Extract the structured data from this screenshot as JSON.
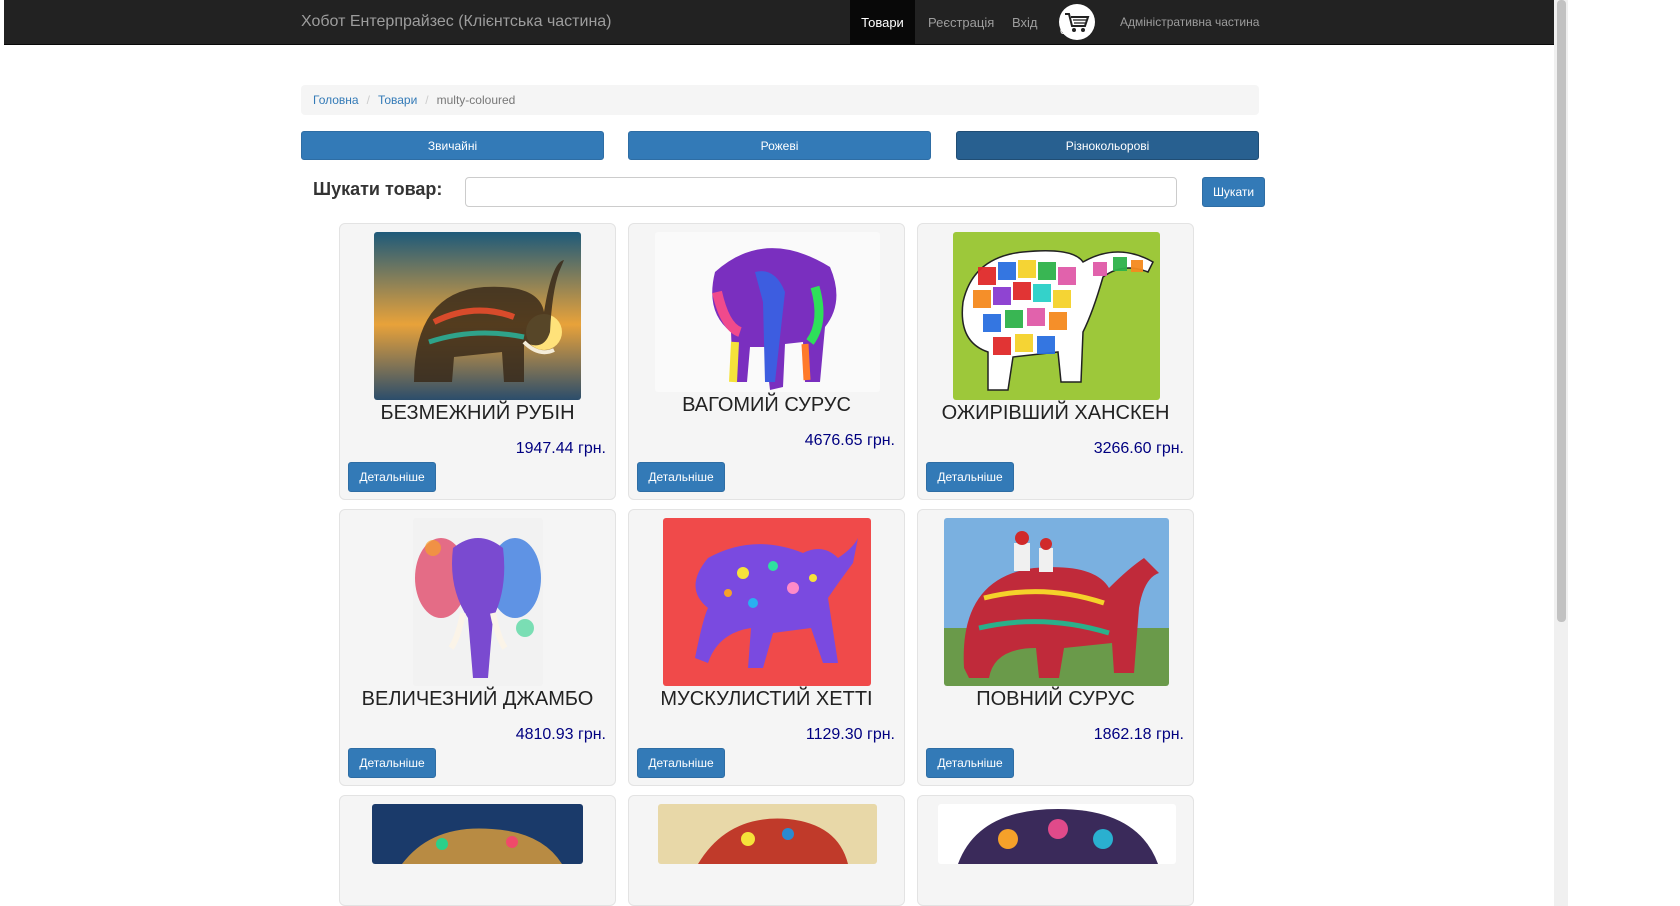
{
  "nav": {
    "brand": "Хобот Ентерпрайзес (Клієнтська частина)",
    "items": [
      "Товари",
      "Реєстрація",
      "Вхід"
    ],
    "active": "Товари",
    "cart_count": "0",
    "admin": "Адміністративна частина"
  },
  "breadcrumb": {
    "home": "Головна",
    "products": "Товари",
    "current": "multy-coloured"
  },
  "categories": [
    "Звичайні",
    "Рожеві",
    "Різнокольорові"
  ],
  "search": {
    "label": "Шукати товар:",
    "value": "",
    "button": "Шукати"
  },
  "products": [
    {
      "name": "БЕЗМЕЖНИЙ РУБІН",
      "price": "1947.44 грн.",
      "details": "Детальніше",
      "image": "elephant-sunset-mandala"
    },
    {
      "name": "ВАГОМИЙ СУРУС",
      "price": "4676.65 грн.",
      "details": "Детальніше",
      "image": "elephant-neon-paint"
    },
    {
      "name": "ОЖИРІВШИЙ ХАНСКЕН",
      "price": "3266.60 грн.",
      "details": "Детальніше",
      "image": "elephant-patchwork"
    },
    {
      "name": "ВЕЛИЧЕЗНИЙ ДЖАМБО",
      "price": "4810.93 грн.",
      "details": "Детальніше",
      "image": "elephant-watercolor"
    },
    {
      "name": "МУСКУЛИСТИЙ ХЕТТІ",
      "price": "1129.30 грн.",
      "details": "Детальніше",
      "image": "elephant-floral-red"
    },
    {
      "name": "ПОВНИЙ СУРУС",
      "price": "1862.18 грн.",
      "details": "Детальніше",
      "image": "elephant-festival-photo"
    }
  ],
  "colors": {
    "navbar": "#222222",
    "primary": "#337ab7",
    "price": "#000080"
  }
}
